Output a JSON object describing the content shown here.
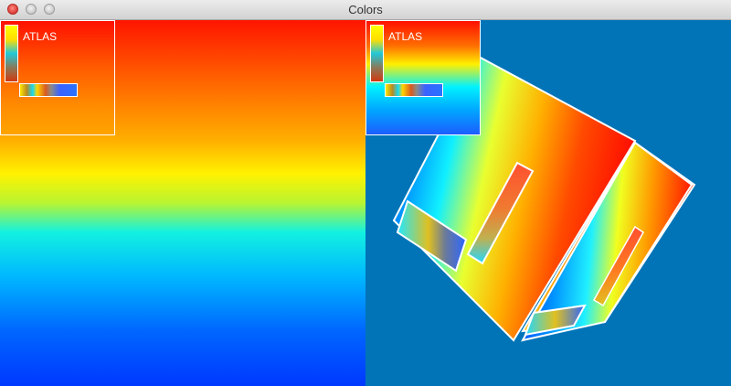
{
  "window": {
    "title": "Colors",
    "controls": {
      "close": "close-icon",
      "minimize": "minimize-icon",
      "zoom": "zoom-icon"
    }
  },
  "atlas": {
    "left_label": "ATLAS",
    "right_label": "ATLAS"
  },
  "colors": {
    "background": "#0174b8",
    "gradient_stops": [
      "#ff1500",
      "#ff6a00",
      "#fff200",
      "#12f1e0",
      "#00b8ff",
      "#0038ff"
    ],
    "outline": "#ffffff"
  }
}
